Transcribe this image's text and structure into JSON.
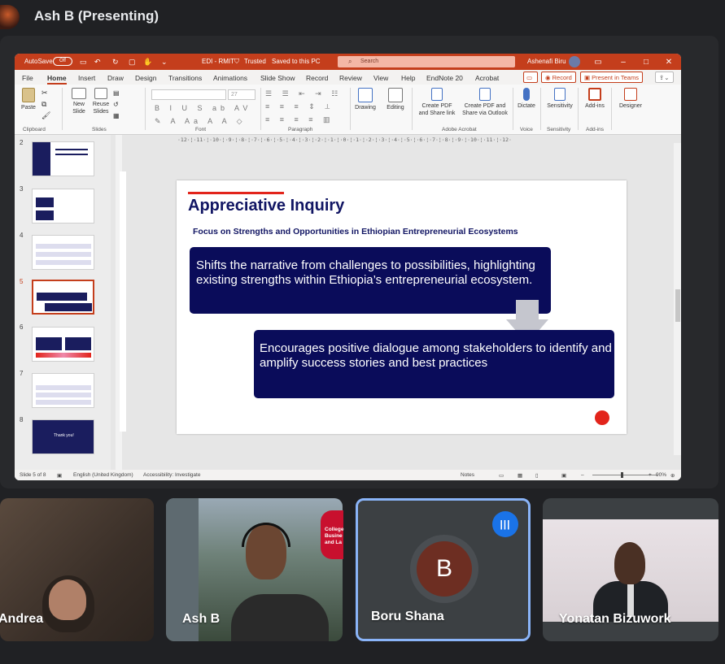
{
  "meet": {
    "presenter_title": "Ash B (Presenting)"
  },
  "ppt": {
    "autosave_label": "AutoSave",
    "autosave_state": "Off",
    "doc_title": "EDI - RMIT",
    "trusted": "Trusted",
    "saved_status": "Saved to this PC",
    "search_placeholder": "Search",
    "user_name": "Ashenafi Biru",
    "menus": [
      "File",
      "Home",
      "Insert",
      "Draw",
      "Design",
      "Transitions",
      "Animations",
      "Slide Show",
      "Record",
      "Review",
      "View",
      "Help",
      "EndNote 20",
      "Acrobat"
    ],
    "record_btn": "Record",
    "present_teams_btn": "Present in Teams",
    "ribbon": {
      "paste": "Paste",
      "new_slide": "New\nSlide",
      "reuse_slides": "Reuse\nSlides",
      "font_size": "27",
      "drawing": "Drawing",
      "editing": "Editing",
      "create_pdf_share": "Create PDF\nand Share link",
      "create_pdf_outlook": "Create PDF and\nShare via Outlook",
      "dictate": "Dictate",
      "sensitivity": "Sensitivity",
      "addins": "Add-ins",
      "designer": "Designer",
      "groups": [
        "Clipboard",
        "Slides",
        "Font",
        "Paragraph",
        "Adobe Acrobat",
        "Voice",
        "Sensitivity",
        "Add-ins"
      ]
    },
    "ruler_text": "·12·¦·11·¦·10·¦·9·¦·8·¦·7·¦·6·¦·5·¦·4·¦·3·¦·2·¦·1·¦·0·¦·1·¦·2·¦·3·¦·4·¦·5·¦·6·¦·7·¦·8·¦·9·¦·10·¦·11·¦·12·",
    "thumb_numbers": [
      "2",
      "3",
      "4",
      "5",
      "6",
      "7",
      "8"
    ],
    "slide": {
      "title": "Appreciative Inquiry",
      "subtitle": "Focus on Strengths and Opportunities in Ethiopian Entrepreneurial Ecosystems",
      "box1_text": "Shifts the narrative from challenges to possibilities, highlighting existing strengths within Ethiopia’s entrepreneurial ecosystem.",
      "box2_text": "Encourages positive dialogue among stakeholders to identify and amplify success stories and best practices"
    },
    "thumb8_text": "Thank you!",
    "status": {
      "slide_info": "Slide 5 of 8",
      "language": "English (United Kingdom)",
      "accessibility": "Accessibility: Investigate",
      "notes": "Notes",
      "zoom": "90%"
    }
  },
  "participants": [
    {
      "name": "Andrea"
    },
    {
      "name": "Ash B"
    },
    {
      "name": "Boru Shana",
      "initial": "B"
    },
    {
      "name": "Yonatan Bizuwork"
    }
  ],
  "sign_text": "College\nBusine\nand La",
  "colors": {
    "ppt_accent": "#c43e1c",
    "slide_navy": "#0a0c5a",
    "slide_red": "#e2241b",
    "speaking_blue": "#1a73e8"
  }
}
